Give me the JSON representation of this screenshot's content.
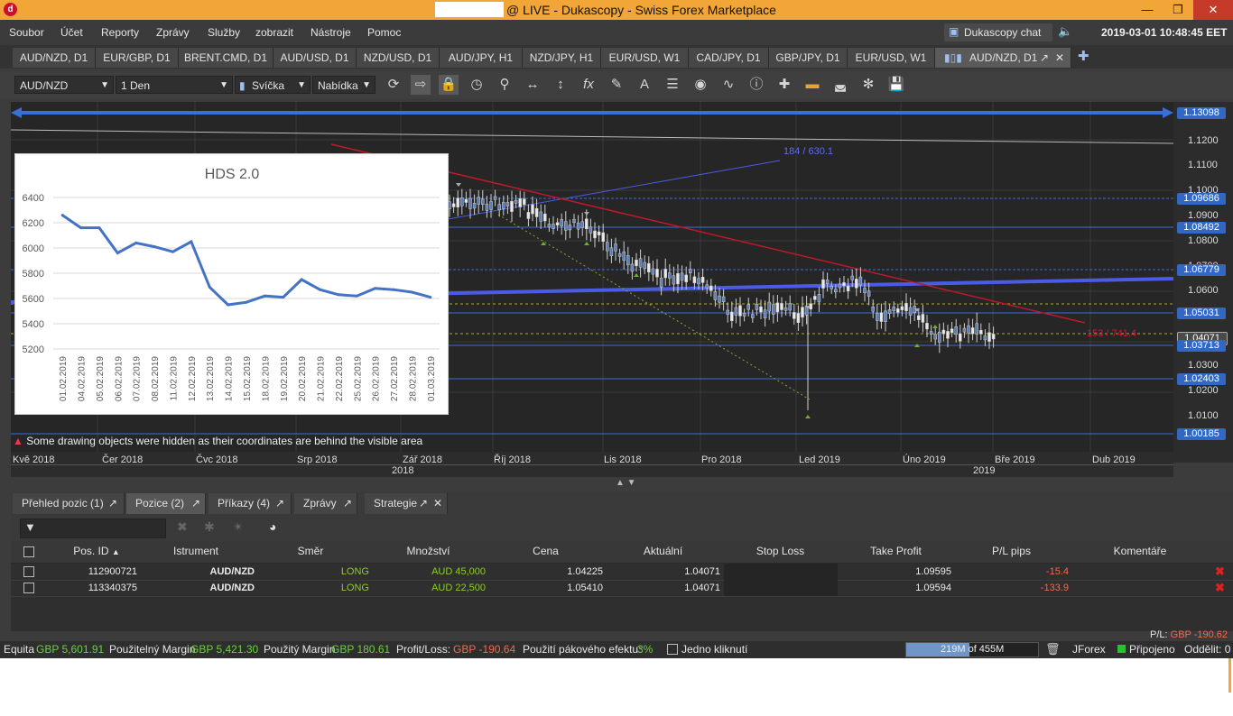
{
  "window": {
    "title": "@ LIVE - Dukascopy - Swiss Forex Marketplace",
    "app_icon": "dukascopy-logo-icon"
  },
  "menu": {
    "items": [
      "Soubor",
      "Účet",
      "Reporty",
      "Zprávy",
      "Služby",
      "zobrazit",
      "Nástroje",
      "Pomoc"
    ],
    "chat_label": "Dukascopy chat",
    "clock": "2019-03-01 10:48:45 EET"
  },
  "chart_tabs": [
    "AUD/NZD, D1",
    "EUR/GBP, D1",
    "BRENT.CMD, D1",
    "AUD/USD, D1",
    "NZD/USD, D1",
    "AUD/JPY, H1",
    "NZD/JPY, H1",
    "EUR/USD, W1",
    "CAD/JPY, D1",
    "GBP/JPY, D1",
    "EUR/USD, W1",
    "AUD/NZD, D1"
  ],
  "toolbar": {
    "instrument": "AUD/NZD",
    "period": "1 Den",
    "chart_type": "Svíčka",
    "offer_side": "Nabídka"
  },
  "chart": {
    "trendline_label": "184 / 630.1",
    "red_line_label": "153 / 741.4",
    "hidden_notice": "Some drawing objects were hidden as their coordinates are behind the visible area",
    "price_labels": [
      "1.13098",
      "1.09686",
      "1.08492",
      "1.06779",
      "1.05031",
      "1.04071",
      "1.03713",
      "1.02403",
      "1.00185"
    ],
    "price_ticks": [
      "1.1200",
      "1.1100",
      "1.1000",
      "1.0900",
      "1.0800",
      "1.0700",
      "1.0600",
      "1.0500",
      "1.0300",
      "1.0200",
      "1.0100"
    ],
    "time_labels": [
      "Kvě 2018",
      "Čer 2018",
      "Čvc 2018",
      "Srp 2018",
      "Zář 2018",
      "Říj 2018",
      "Lis 2018",
      "Pro 2018",
      "Led 2019",
      "Úno 2019",
      "Bře 2019",
      "Dub 2019"
    ],
    "year_labels": [
      "2018",
      "2019"
    ]
  },
  "chart_data": {
    "type": "line",
    "title": "HDS 2.0",
    "xlabel": "",
    "ylabel": "",
    "ylim": [
      5200,
      6400
    ],
    "yticks": [
      5200,
      5400,
      5600,
      5800,
      6000,
      6200,
      6400
    ],
    "categories": [
      "01.02.2019",
      "04.02.2019",
      "05.02.2019",
      "06.02.2019",
      "07.02.2019",
      "08.02.2019",
      "11.02.2019",
      "12.02.2019",
      "13.02.2019",
      "14.02.2019",
      "15.02.2019",
      "18.02.2019",
      "19.02.2019",
      "20.02.2019",
      "21.02.2019",
      "22.02.2019",
      "25.02.2019",
      "26.02.2019",
      "27.02.2019",
      "28.02.2019",
      "01.03.2019"
    ],
    "values": [
      6260,
      6160,
      6160,
      5960,
      6040,
      6010,
      5970,
      6050,
      5690,
      5550,
      5570,
      5620,
      5610,
      5750,
      5670,
      5630,
      5620,
      5680,
      5670,
      5650,
      5610
    ],
    "line_color": "#4472c4"
  },
  "bottom_tabs": [
    "Přehled pozic (1)",
    "Pozice (2)",
    "Příkazy (4)",
    "Zprávy",
    "Strategie"
  ],
  "positions": {
    "columns": [
      "Pos. ID",
      "Istrument",
      "Směr",
      "Množství",
      "Cena",
      "Aktuální",
      "Stop Loss",
      "Take Profit",
      "P/L pips",
      "Komentáře"
    ],
    "rows": [
      {
        "id": "112900721",
        "instrument": "AUD/NZD",
        "direction": "LONG",
        "amount": "AUD 45,000",
        "price": "1.04225",
        "current": "1.04071",
        "stop_loss": "",
        "take_profit": "1.09595",
        "pl_pips": "-15.4",
        "comment": ""
      },
      {
        "id": "113340375",
        "instrument": "AUD/NZD",
        "direction": "LONG",
        "amount": "AUD 22,500",
        "price": "1.05410",
        "current": "1.04071",
        "stop_loss": "",
        "take_profit": "1.09594",
        "pl_pips": "-133.9",
        "comment": ""
      }
    ],
    "pl_label": "P/L:",
    "pl_value": "GBP -190.62"
  },
  "status": {
    "equity_label": "Equita",
    "equity_value": "GBP 5,601.91",
    "usable_margin_label": "Použitelný Margin",
    "usable_margin_value": "GBP 5,421.30",
    "used_margin_label": "Použitý Margin",
    "used_margin_value": "GBP 180.61",
    "profit_loss_label": "Profit/Loss:",
    "profit_loss_value": "GBP -190.64",
    "leverage_label": "Použití pákového efektu:",
    "leverage_value": "3%",
    "one_click_label": "Jedno kliknutí",
    "memory_label": "219M of 455M",
    "memory_used_fraction": 0.48,
    "platform_label": "JForex",
    "connected_label": "Připojeno",
    "delay_label": "Oddělit: 0"
  }
}
